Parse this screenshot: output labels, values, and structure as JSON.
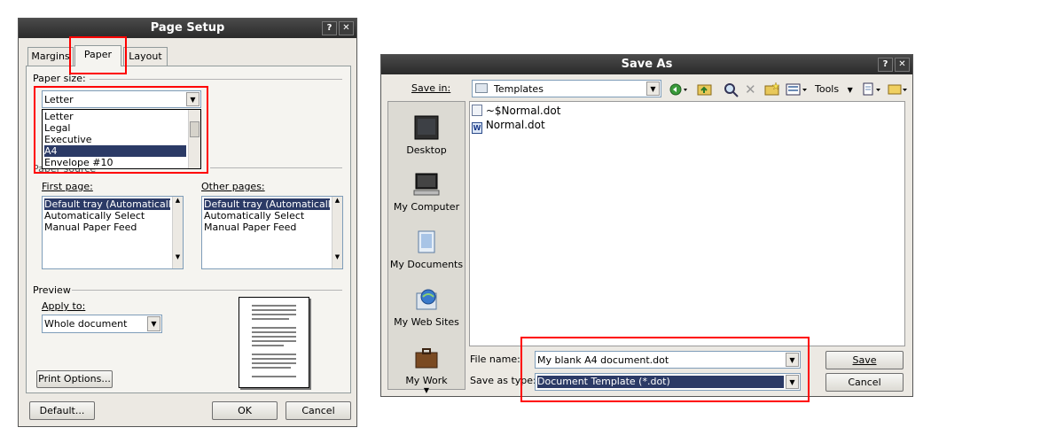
{
  "page_setup": {
    "title": "Page Setup",
    "help_btn": "?",
    "close_btn": "✕",
    "tabs": [
      "Margins",
      "Paper",
      "Layout"
    ],
    "paper_size_label": "Paper size:",
    "paper_size_value": "Letter",
    "paper_size_options": [
      "Letter",
      "Legal",
      "Executive",
      "A4",
      "Envelope #10"
    ],
    "paper_source_label": "Paper source",
    "first_page_label": "First page:",
    "other_pages_label": "Other pages:",
    "first_page_items": [
      "Default tray (Automatically Se",
      "Automatically Select",
      "Manual Paper Feed"
    ],
    "other_pages_items": [
      "Default tray (Automatically Se",
      "Automatically Select",
      "Manual Paper Feed"
    ],
    "preview_label": "Preview",
    "apply_to_label": "Apply to:",
    "apply_to_value": "Whole document",
    "print_options_btn": "Print Options...",
    "default_btn": "Default...",
    "ok_btn": "OK",
    "cancel_btn": "Cancel"
  },
  "save_as": {
    "title": "Save As",
    "help_btn": "?",
    "close_btn": "✕",
    "save_in_label": "Save in:",
    "save_in_value": "Templates",
    "tools_label": "Tools",
    "places": [
      "Desktop",
      "My Computer",
      "My Documents",
      "My Web Sites",
      "My Work"
    ],
    "files": [
      "~$Normal.dot",
      "Normal.dot"
    ],
    "file_name_label": "File name:",
    "file_name_value": "My blank A4 document.dot",
    "save_type_label": "Save as type:",
    "save_type_value": "Document Template (*.dot)",
    "save_btn": "Save",
    "cancel_btn": "Cancel"
  },
  "colors": {
    "highlight": "#ff0000",
    "selection": "#2b3a66",
    "titlebar": "#333333"
  }
}
